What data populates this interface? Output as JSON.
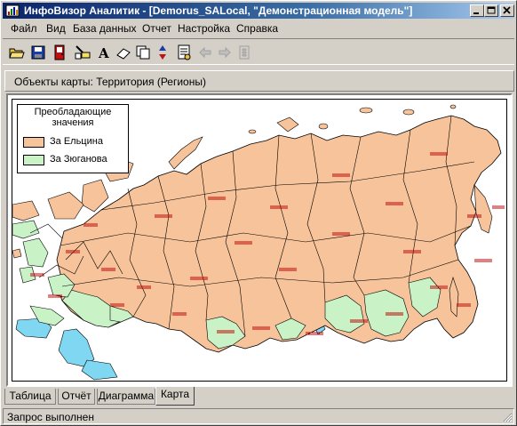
{
  "window": {
    "title": "ИнфоВизор Аналитик - [Demorus_SALocal, \"Демонстрационная модель\"]"
  },
  "menu": [
    {
      "label": "Файл"
    },
    {
      "label": "Вид"
    },
    {
      "label": "База данных"
    },
    {
      "label": "Отчет"
    },
    {
      "label": "Настройка"
    },
    {
      "label": "Справка"
    }
  ],
  "toolbar": {
    "icons": [
      "open-folder-icon",
      "save-icon",
      "exit-door-icon",
      "properties-icon",
      "font-icon",
      "eraser-icon",
      "copy-icon",
      "sort-icon",
      "report-icon",
      "back-arrow-icon",
      "forward-arrow-icon",
      "calculator-icon"
    ]
  },
  "panel": {
    "title": "Объекты карты: Территория (Регионы)"
  },
  "legend": {
    "title_line1": "Преобладающие",
    "title_line2": "значения",
    "items": [
      {
        "label": "За Ельцина",
        "color": "#f7c39a"
      },
      {
        "label": "За Зюганова",
        "color": "#c9f2c6"
      }
    ]
  },
  "map": {
    "land_color": "#f7c39a",
    "alt_color": "#c9f2c6",
    "water_color": "#7fd7f2",
    "border_color": "#000000"
  },
  "tabs": [
    {
      "label": "Таблица",
      "active": false
    },
    {
      "label": "Отчёт",
      "active": false
    },
    {
      "label": "Диаграмма",
      "active": false
    },
    {
      "label": "Карта",
      "active": true
    }
  ],
  "status": {
    "text": "Запрос выполнен"
  }
}
